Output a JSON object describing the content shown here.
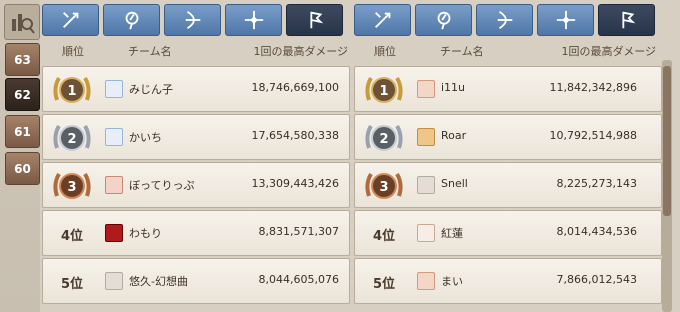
{
  "header": {
    "rank": "順位",
    "team": "チーム名",
    "damage": "1回の最高ダメージ"
  },
  "levels": [
    "63",
    "62",
    "61",
    "60"
  ],
  "active_level": "62",
  "tabs": [
    "sword-icon",
    "magic-icon",
    "bow-icon",
    "cross-icon",
    "banner-icon"
  ],
  "left_rows": [
    {
      "rank": "1",
      "name": "みじん子",
      "damage": "18,746,669,100"
    },
    {
      "rank": "2",
      "name": "かいち",
      "damage": "17,654,580,338"
    },
    {
      "rank": "3",
      "name": "ぼってりっぷ",
      "damage": "13,309,443,426"
    },
    {
      "rank": "4位",
      "name": "わもり",
      "damage": "8,831,571,307"
    },
    {
      "rank": "5位",
      "name": "悠久-幻想曲",
      "damage": "8,044,605,076"
    }
  ],
  "right_rows": [
    {
      "rank": "1",
      "name": "i11u",
      "damage": "11,842,342,896"
    },
    {
      "rank": "2",
      "name": "Roar",
      "damage": "10,792,514,988"
    },
    {
      "rank": "3",
      "name": "Snell",
      "damage": "8,225,273,143"
    },
    {
      "rank": "4位",
      "name": "紅蓮",
      "damage": "8,014,434,536"
    },
    {
      "rank": "5位",
      "name": "まい",
      "damage": "7,866,012,543"
    }
  ],
  "colors": {
    "gold": "#c79a3a",
    "silver": "#9aa3ad",
    "bronze": "#b06a3c",
    "tab_blue": "#5b82b4",
    "tab_active": "#2f3b52"
  }
}
